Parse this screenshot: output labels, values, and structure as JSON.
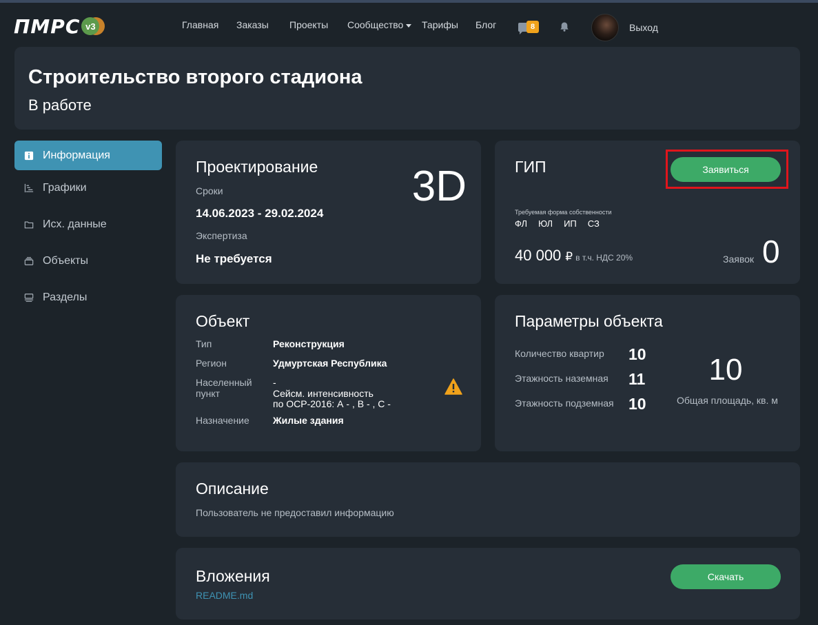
{
  "brand": {
    "logo_text": "ПМРС",
    "version": "v3"
  },
  "nav": {
    "items": [
      "Главная",
      "Заказы",
      "Проекты",
      "Сообщество",
      "Тарифы",
      "Блог"
    ],
    "messages_count": "8",
    "logout": "Выход"
  },
  "project": {
    "title": "Строительство второго стадиона",
    "status": "В работе"
  },
  "sidebar": {
    "items": [
      {
        "label": "Информация",
        "icon": "info-icon",
        "active": true
      },
      {
        "label": "Графики",
        "icon": "gantt-icon",
        "active": false
      },
      {
        "label": "Исх. данные",
        "icon": "folder-icon",
        "active": false
      },
      {
        "label": "Объекты",
        "icon": "layers-icon",
        "active": false
      },
      {
        "label": "Разделы",
        "icon": "sections-icon",
        "active": false
      }
    ]
  },
  "design": {
    "heading": "Проектирование",
    "type_label": "3D",
    "terms_label": "Сроки",
    "terms_value": "14.06.2023 - 29.02.2024",
    "expertise_label": "Экспертиза",
    "expertise_value": "Не требуется"
  },
  "gip": {
    "heading": "ГИП",
    "apply_button": "Заявиться",
    "ownership_label": "Требуемая форма собственности",
    "ownership_forms": [
      "ФЛ",
      "ЮЛ",
      "ИП",
      "СЗ"
    ],
    "price": "40 000",
    "currency": "₽",
    "vat_note": "в т.ч. НДС 20%",
    "requests_label": "Заявок",
    "requests_count": "0"
  },
  "object": {
    "heading": "Объект",
    "type_label": "Тип",
    "type_value": "Реконструкция",
    "region_label": "Регион",
    "region_value": "Удмуртская Республика",
    "locality_label_1": "Населенный",
    "locality_label_2": "пункт",
    "locality_value": "-",
    "seismic_line1": "Сейсм. интенсивность",
    "seismic_line2": "по ОСР-2016: А - , В - , С -",
    "purpose_label": "Назначение",
    "purpose_value": "Жилые здания"
  },
  "params": {
    "heading": "Параметры объекта",
    "apartments_label": "Количество квартир",
    "apartments_value": "10",
    "floors_above_label": "Этажность наземная",
    "floors_above_value": "11",
    "floors_below_label": "Этажность подземная",
    "floors_below_value": "10",
    "area_value": "10",
    "area_label": "Общая площадь, кв. м"
  },
  "description": {
    "heading": "Описание",
    "text": "Пользователь не предоставил информацию"
  },
  "attachments": {
    "heading": "Вложения",
    "file": "README.md",
    "download_button": "Скачать"
  },
  "colors": {
    "background": "#1c2329",
    "card": "#262e37",
    "accent": "#3f93b3",
    "button": "#3daa67",
    "warning": "#f0a21b",
    "highlight": "#e0151c"
  }
}
